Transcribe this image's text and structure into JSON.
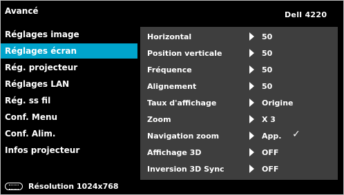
{
  "header": {
    "title": "Avancé",
    "model": "Dell 4220"
  },
  "menu": {
    "items": [
      {
        "label": "Réglages image",
        "selected": false
      },
      {
        "label": "Réglages écran",
        "selected": true
      },
      {
        "label": "Rég. projecteur",
        "selected": false
      },
      {
        "label": "Réglages LAN",
        "selected": false
      },
      {
        "label": "Rég. ss fil",
        "selected": false
      },
      {
        "label": "Conf. Menu",
        "selected": false
      },
      {
        "label": "Conf. Alim.",
        "selected": false
      },
      {
        "label": "Infos projecteur",
        "selected": false
      }
    ]
  },
  "panel": {
    "rows": [
      {
        "label": "Horizontal",
        "value": "50",
        "check": ""
      },
      {
        "label": "Position verticale",
        "value": "50",
        "check": ""
      },
      {
        "label": "Fréquence",
        "value": "50",
        "check": ""
      },
      {
        "label": "Alignement",
        "value": "50",
        "check": ""
      },
      {
        "label": "Taux d'affichage",
        "value": "Origine",
        "check": ""
      },
      {
        "label": "Zoom",
        "value": "X 3",
        "check": ""
      },
      {
        "label": "Navigation zoom",
        "value": "App.",
        "check": "✓"
      },
      {
        "label": "Affichage 3D",
        "value": "OFF",
        "check": ""
      },
      {
        "label": "Inversion 3D Sync",
        "value": "OFF",
        "check": ""
      }
    ]
  },
  "footer": {
    "icon": "remote-keypad-icon",
    "resolution": "Résolution   1024x768"
  },
  "colors": {
    "accent": "#00a4cc",
    "panel_bg": "#3e3e3e",
    "background": "#000000"
  }
}
